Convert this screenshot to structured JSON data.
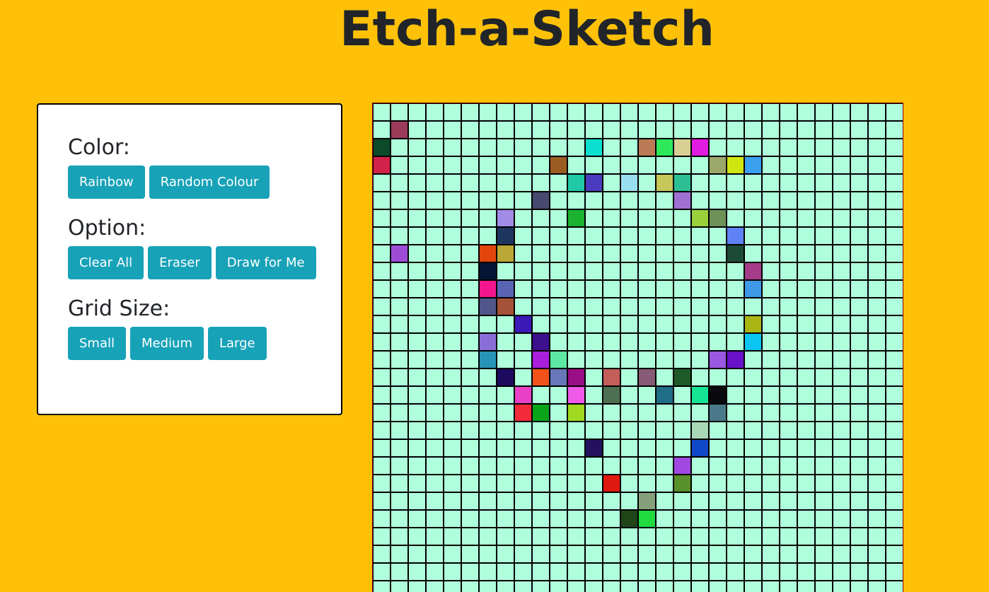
{
  "header": {
    "title": "Etch-a-Sketch"
  },
  "panel": {
    "color_label": "Color:",
    "color_buttons": [
      "Rainbow",
      "Random Colour"
    ],
    "option_label": "Option:",
    "option_buttons": [
      "Clear All",
      "Eraser",
      "Draw for Me"
    ],
    "grid_size_label": "Grid Size:",
    "grid_size_buttons": [
      "Small",
      "Medium",
      "Large"
    ]
  },
  "sketch_grid": {
    "columns": 30,
    "visible_rows": 28,
    "background_color": "#AFFFDC",
    "line_color": "#000000",
    "painted_cells": [
      {
        "r": 1,
        "c": 1,
        "color": "#9B3B5A"
      },
      {
        "r": 2,
        "c": 0,
        "color": "#0B4A2A"
      },
      {
        "r": 2,
        "c": 12,
        "color": "#0BE0D0"
      },
      {
        "r": 2,
        "c": 15,
        "color": "#B97A55"
      },
      {
        "r": 2,
        "c": 16,
        "color": "#2EE85C"
      },
      {
        "r": 2,
        "c": 17,
        "color": "#D8CF94"
      },
      {
        "r": 2,
        "c": 18,
        "color": "#E21BE0"
      },
      {
        "r": 3,
        "c": 0,
        "color": "#D3224A"
      },
      {
        "r": 3,
        "c": 10,
        "color": "#9B5C22"
      },
      {
        "r": 3,
        "c": 19,
        "color": "#9BA869"
      },
      {
        "r": 3,
        "c": 20,
        "color": "#CFE612"
      },
      {
        "r": 3,
        "c": 21,
        "color": "#3BA0F0"
      },
      {
        "r": 4,
        "c": 11,
        "color": "#20C9A8"
      },
      {
        "r": 4,
        "c": 12,
        "color": "#4B3BBE"
      },
      {
        "r": 4,
        "c": 14,
        "color": "#9ADFEF"
      },
      {
        "r": 4,
        "c": 16,
        "color": "#C6C85A"
      },
      {
        "r": 4,
        "c": 17,
        "color": "#2DBF94"
      },
      {
        "r": 5,
        "c": 9,
        "color": "#474A6E"
      },
      {
        "r": 5,
        "c": 17,
        "color": "#A070D3"
      },
      {
        "r": 6,
        "c": 7,
        "color": "#A08CE6"
      },
      {
        "r": 6,
        "c": 11,
        "color": "#1AB22E"
      },
      {
        "r": 6,
        "c": 18,
        "color": "#9AD03A"
      },
      {
        "r": 6,
        "c": 19,
        "color": "#6D9157"
      },
      {
        "r": 7,
        "c": 7,
        "color": "#1D355F"
      },
      {
        "r": 7,
        "c": 20,
        "color": "#5E82F6"
      },
      {
        "r": 8,
        "c": 1,
        "color": "#9E4CD6"
      },
      {
        "r": 8,
        "c": 6,
        "color": "#E2460C"
      },
      {
        "r": 8,
        "c": 7,
        "color": "#B9A835"
      },
      {
        "r": 8,
        "c": 20,
        "color": "#1C4A36"
      },
      {
        "r": 9,
        "c": 6,
        "color": "#041634"
      },
      {
        "r": 9,
        "c": 21,
        "color": "#A43C8A"
      },
      {
        "r": 10,
        "c": 6,
        "color": "#F2168F"
      },
      {
        "r": 10,
        "c": 7,
        "color": "#5A64B5"
      },
      {
        "r": 10,
        "c": 21,
        "color": "#3E9AE8"
      },
      {
        "r": 11,
        "c": 6,
        "color": "#50558A"
      },
      {
        "r": 11,
        "c": 7,
        "color": "#A4523A"
      },
      {
        "r": 12,
        "c": 8,
        "color": "#3B18B8"
      },
      {
        "r": 12,
        "c": 21,
        "color": "#A8B512"
      },
      {
        "r": 13,
        "c": 6,
        "color": "#8A6ED8"
      },
      {
        "r": 13,
        "c": 9,
        "color": "#3D108E"
      },
      {
        "r": 13,
        "c": 21,
        "color": "#0BC6F3"
      },
      {
        "r": 14,
        "c": 6,
        "color": "#2695B8"
      },
      {
        "r": 14,
        "c": 9,
        "color": "#A91FDA"
      },
      {
        "r": 14,
        "c": 10,
        "color": "#5EE8A1"
      },
      {
        "r": 14,
        "c": 19,
        "color": "#9A58E0"
      },
      {
        "r": 14,
        "c": 20,
        "color": "#6912C8"
      },
      {
        "r": 15,
        "c": 7,
        "color": "#1D0A5E"
      },
      {
        "r": 15,
        "c": 9,
        "color": "#F2521A"
      },
      {
        "r": 15,
        "c": 10,
        "color": "#6778B8"
      },
      {
        "r": 15,
        "c": 11,
        "color": "#9A0E86"
      },
      {
        "r": 15,
        "c": 13,
        "color": "#C35E5A"
      },
      {
        "r": 15,
        "c": 15,
        "color": "#875A75"
      },
      {
        "r": 15,
        "c": 17,
        "color": "#1E5A28"
      },
      {
        "r": 16,
        "c": 8,
        "color": "#EA40C8"
      },
      {
        "r": 16,
        "c": 11,
        "color": "#F05AE8"
      },
      {
        "r": 16,
        "c": 13,
        "color": "#4E7052"
      },
      {
        "r": 16,
        "c": 16,
        "color": "#1E6E88"
      },
      {
        "r": 16,
        "c": 18,
        "color": "#16E495"
      },
      {
        "r": 16,
        "c": 19,
        "color": "#0A0A0E"
      },
      {
        "r": 17,
        "c": 8,
        "color": "#F22A3A"
      },
      {
        "r": 17,
        "c": 9,
        "color": "#0AA41A"
      },
      {
        "r": 17,
        "c": 11,
        "color": "#A0DA20"
      },
      {
        "r": 17,
        "c": 19,
        "color": "#4A7A8A"
      },
      {
        "r": 18,
        "c": 18,
        "color": "#A8D8B5"
      },
      {
        "r": 19,
        "c": 12,
        "color": "#23105E"
      },
      {
        "r": 19,
        "c": 18,
        "color": "#0F48C8"
      },
      {
        "r": 20,
        "c": 17,
        "color": "#A048E0"
      },
      {
        "r": 21,
        "c": 13,
        "color": "#DE1A10"
      },
      {
        "r": 21,
        "c": 17,
        "color": "#58902A"
      },
      {
        "r": 22,
        "c": 15,
        "color": "#86A07C"
      },
      {
        "r": 23,
        "c": 14,
        "color": "#1F4418"
      },
      {
        "r": 23,
        "c": 15,
        "color": "#20DA40"
      }
    ]
  }
}
